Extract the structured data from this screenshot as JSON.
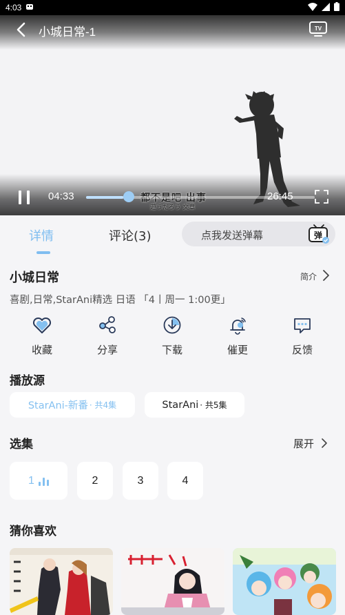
{
  "status": {
    "time": "4:03"
  },
  "player": {
    "title": "小城日常-1",
    "current_time": "04:33",
    "duration": "26:45",
    "progress": 0.162,
    "subtitle_main": "都不是吧 出事",
    "subtitle_jp": "遊うだろう 文章"
  },
  "tabs": [
    {
      "label": "详情",
      "active": true
    },
    {
      "label": "评论(3)",
      "active": false
    }
  ],
  "danmu": {
    "placeholder": "点我发送弹幕",
    "icon_label": "弹"
  },
  "show": {
    "title": "小城日常",
    "intro_label": "简介",
    "meta": "喜剧,日常,StarAni精选 日语 「4丨周一 1:00更」"
  },
  "actions": [
    {
      "label": "收藏",
      "icon": "heart-icon"
    },
    {
      "label": "分享",
      "icon": "share-icon"
    },
    {
      "label": "下载",
      "icon": "download-icon"
    },
    {
      "label": "催更",
      "icon": "bell-icon"
    },
    {
      "label": "反馈",
      "icon": "feedback-icon"
    }
  ],
  "sources": {
    "title": "播放源",
    "items": [
      {
        "name": "StarAni-新番",
        "count": "· 共4集",
        "selected": true
      },
      {
        "name": "StarAni",
        "count": "· 共5集",
        "selected": false
      }
    ]
  },
  "episodes": {
    "title": "选集",
    "expand_label": "展开",
    "items": [
      "1",
      "2",
      "3",
      "4"
    ],
    "selected": "1"
  },
  "recommend": {
    "title": "猜你喜欢"
  },
  "colors": {
    "accent": "#7fbdf0",
    "background": "#f5f5f7",
    "card": "#ffffff"
  }
}
